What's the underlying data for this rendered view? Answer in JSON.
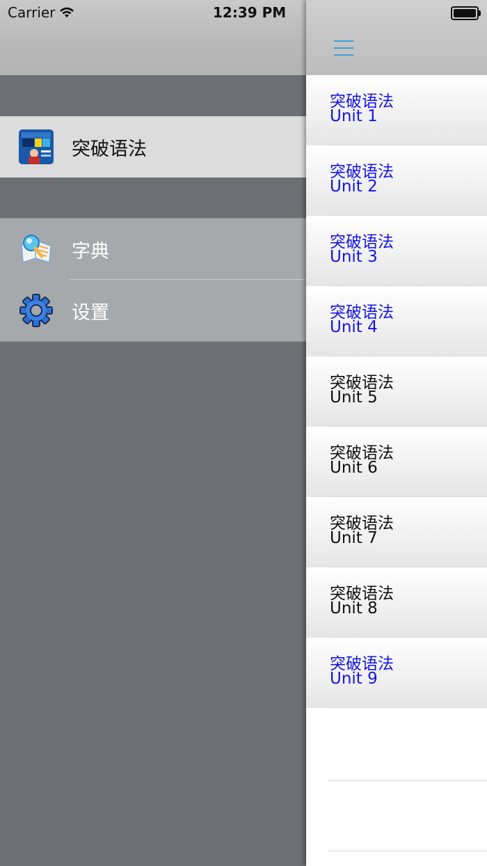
{
  "status_bar": {
    "carrier": "Carrier",
    "time": "12:39 PM"
  },
  "menu": {
    "app_item": {
      "label": "突破语法",
      "icon": "app-cover-icon"
    },
    "items": [
      {
        "label": "字典",
        "icon": "dictionary-icon"
      },
      {
        "label": "设置",
        "icon": "gear-icon"
      }
    ]
  },
  "panel": {
    "menu_icon": "hamburger-icon",
    "units": [
      {
        "title": "突破语法",
        "unit": "Unit 1",
        "color": "#1414e6"
      },
      {
        "title": "突破语法",
        "unit": "Unit 2",
        "color": "#1414e6"
      },
      {
        "title": "突破语法",
        "unit": "Unit 3",
        "color": "#1414e6"
      },
      {
        "title": "突破语法",
        "unit": "Unit 4",
        "color": "#1414e6"
      },
      {
        "title": "突破语法",
        "unit": "Unit 5",
        "color": "#111111"
      },
      {
        "title": "突破语法",
        "unit": "Unit 6",
        "color": "#111111"
      },
      {
        "title": "突破语法",
        "unit": "Unit 7",
        "color": "#111111"
      },
      {
        "title": "突破语法",
        "unit": "Unit 8",
        "color": "#111111"
      },
      {
        "title": "突破语法",
        "unit": "Unit 9",
        "color": "#1414e6"
      }
    ]
  }
}
